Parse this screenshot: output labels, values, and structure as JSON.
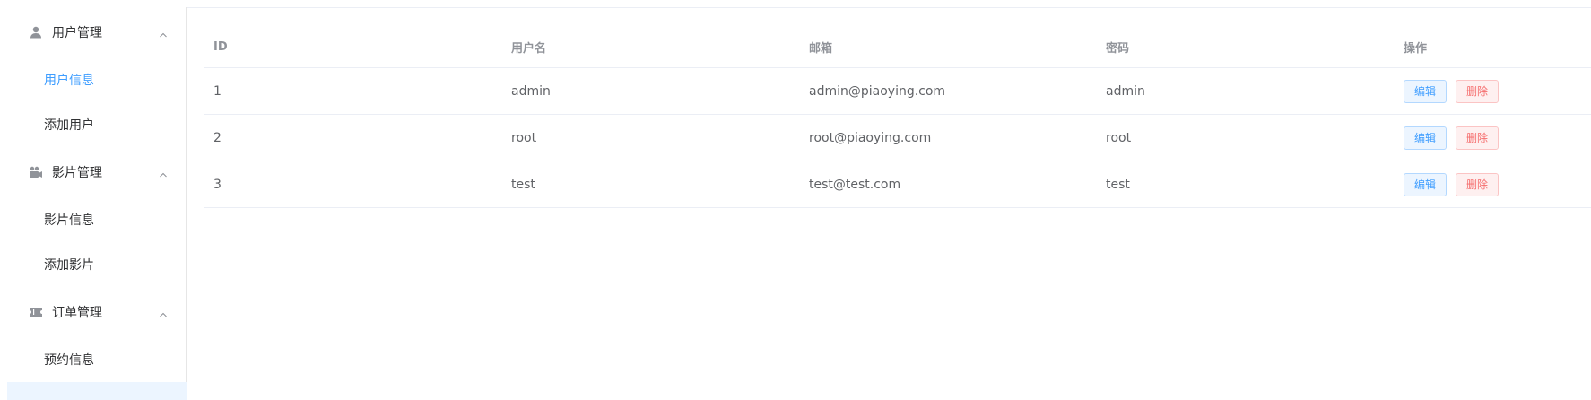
{
  "sidebar": {
    "groups": [
      {
        "title": "用户管理",
        "icon": "user-icon",
        "items": [
          {
            "label": "用户信息",
            "active": true
          },
          {
            "label": "添加用户",
            "active": false
          }
        ]
      },
      {
        "title": "影片管理",
        "icon": "video-camera-icon",
        "items": [
          {
            "label": "影片信息",
            "active": false
          },
          {
            "label": "添加影片",
            "active": false
          }
        ]
      },
      {
        "title": "订单管理",
        "icon": "ticket-icon",
        "items": [
          {
            "label": "预约信息",
            "active": false
          }
        ]
      }
    ]
  },
  "table": {
    "columns": [
      "ID",
      "用户名",
      "邮箱",
      "密码",
      "操作"
    ],
    "rows": [
      {
        "id": "1",
        "username": "admin",
        "email": "admin@piaoying.com",
        "password": "admin"
      },
      {
        "id": "2",
        "username": "root",
        "email": "root@piaoying.com",
        "password": "root"
      },
      {
        "id": "3",
        "username": "test",
        "email": "test@test.com",
        "password": "test"
      }
    ],
    "actions": {
      "edit": "编辑",
      "delete": "删除"
    }
  },
  "colors": {
    "accent": "#409eff",
    "danger": "#f56c6c",
    "border": "#ebeef5"
  }
}
